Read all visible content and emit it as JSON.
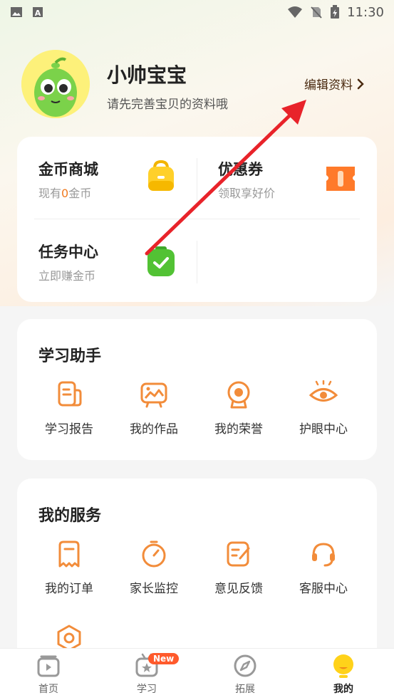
{
  "status_bar": {
    "time": "11:30",
    "icons": [
      "image-icon",
      "a-icon",
      "wifi-icon",
      "no-sim-icon",
      "battery-charging-icon"
    ]
  },
  "profile": {
    "nickname": "小帅宝宝",
    "tip": "请先完善宝贝的资料哦",
    "edit_label": "编辑资料"
  },
  "quick_entries": {
    "coin_mall": {
      "title": "金币商城",
      "sub_prefix": "现有",
      "coin_count": "0",
      "sub_suffix": "金币"
    },
    "coupon": {
      "title": "优惠券",
      "sub": "领取享好价"
    },
    "task_center": {
      "title": "任务中心",
      "sub": "立即赚金币"
    }
  },
  "study_helper": {
    "title": "学习助手",
    "items": [
      {
        "label": "学习报告",
        "icon": "report-icon"
      },
      {
        "label": "我的作品",
        "icon": "artwork-icon"
      },
      {
        "label": "我的荣誉",
        "icon": "honor-icon"
      },
      {
        "label": "护眼中心",
        "icon": "eye-icon"
      }
    ]
  },
  "my_services": {
    "title": "我的服务",
    "items": [
      {
        "label": "我的订单",
        "icon": "order-icon"
      },
      {
        "label": "家长监控",
        "icon": "timer-icon"
      },
      {
        "label": "意见反馈",
        "icon": "feedback-icon"
      },
      {
        "label": "客服中心",
        "icon": "headset-icon"
      },
      {
        "label": "",
        "icon": "settings-icon"
      }
    ]
  },
  "tabbar": {
    "items": [
      {
        "label": "首页",
        "icon": "home-play-icon"
      },
      {
        "label": "学习",
        "icon": "study-tv-icon",
        "badge": "New"
      },
      {
        "label": "拓展",
        "icon": "compass-icon"
      },
      {
        "label": "我的",
        "icon": "me-icon",
        "active": true
      }
    ]
  },
  "colors": {
    "accent": "#f07a20",
    "arrow": "#e8232a",
    "icon_orange": "#f28c3a"
  }
}
